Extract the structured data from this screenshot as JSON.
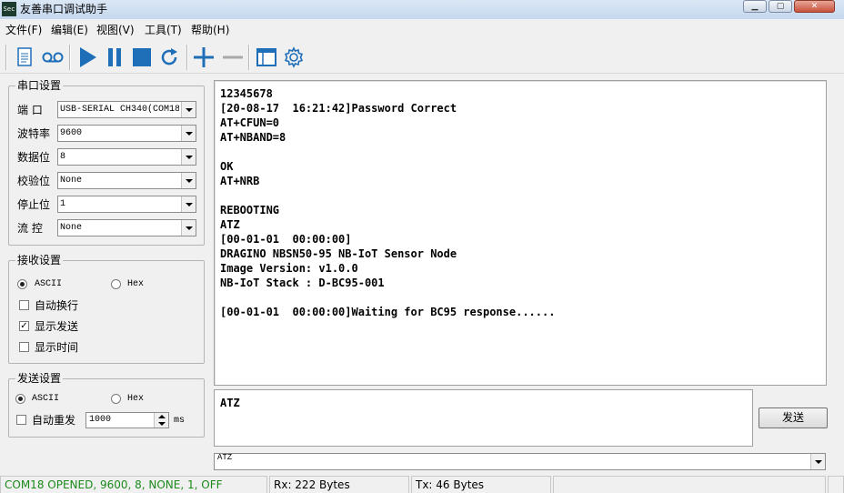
{
  "window": {
    "title": "友善串口调试助手",
    "icon_text": "Sec",
    "min_icon": "minimize-icon",
    "max_icon": "maximize-icon",
    "close_icon": "close-icon"
  },
  "menu": [
    {
      "label": "文件(F)"
    },
    {
      "label": "编辑(E)"
    },
    {
      "label": "视图(V)"
    },
    {
      "label": "工具(T)"
    },
    {
      "label": "帮助(H)"
    }
  ],
  "toolbar": {
    "icons": [
      "document-icon",
      "record-icon",
      "play-icon",
      "pause-icon",
      "stop-icon",
      "refresh-icon",
      "add-icon",
      "remove-icon",
      "window-icon",
      "settings-icon"
    ],
    "accent": "#1f6fb8"
  },
  "serial_settings": {
    "title": "串口设置",
    "port": {
      "label": "端  口",
      "value": "USB-SERIAL CH340(COM18"
    },
    "baud": {
      "label": "波特率",
      "value": "9600"
    },
    "data_bits": {
      "label": "数据位",
      "value": "8"
    },
    "parity": {
      "label": "校验位",
      "value": "None"
    },
    "stop_bits": {
      "label": "停止位",
      "value": "1"
    },
    "flow": {
      "label": "流  控",
      "value": "None"
    }
  },
  "receive_settings": {
    "title": "接收设置",
    "ascii_label": "ASCII",
    "hex_label": "Hex",
    "mode_selected": "ASCII",
    "auto_newline": {
      "label": "自动换行",
      "checked": false
    },
    "show_send": {
      "label": "显示发送",
      "checked": true
    },
    "show_time": {
      "label": "显示时间",
      "checked": false
    }
  },
  "send_settings": {
    "title": "发送设置",
    "ascii_label": "ASCII",
    "hex_label": "Hex",
    "mode_selected": "ASCII",
    "auto_resend": {
      "label": "自动重发",
      "checked": false
    },
    "interval": "1000",
    "interval_unit": "ms"
  },
  "receive_lines": [
    "12345678",
    "[20-08-17  16:21:42]Password Correct",
    "AT+CFUN=0",
    "AT+NBAND=8",
    "",
    "OK",
    "AT+NRB",
    "",
    "REBOOTING",
    "ATZ",
    "[00-01-01  00:00:00]",
    "DRAGINO NBSN50-95 NB-IoT Sensor Node",
    "Image Version: v1.0.0",
    "NB-IoT Stack : D-BC95-001",
    "",
    "[00-01-01  00:00:00]Waiting for BC95 response......"
  ],
  "send_text": "ATZ",
  "send_button": "发送",
  "history_value": "ATZ",
  "status": {
    "port": "COM18 OPENED, 9600, 8, NONE, 1, OFF",
    "rx": "Rx: 222 Bytes",
    "tx": "Tx: 46 Bytes",
    "port_color": "#1b8a1b"
  }
}
